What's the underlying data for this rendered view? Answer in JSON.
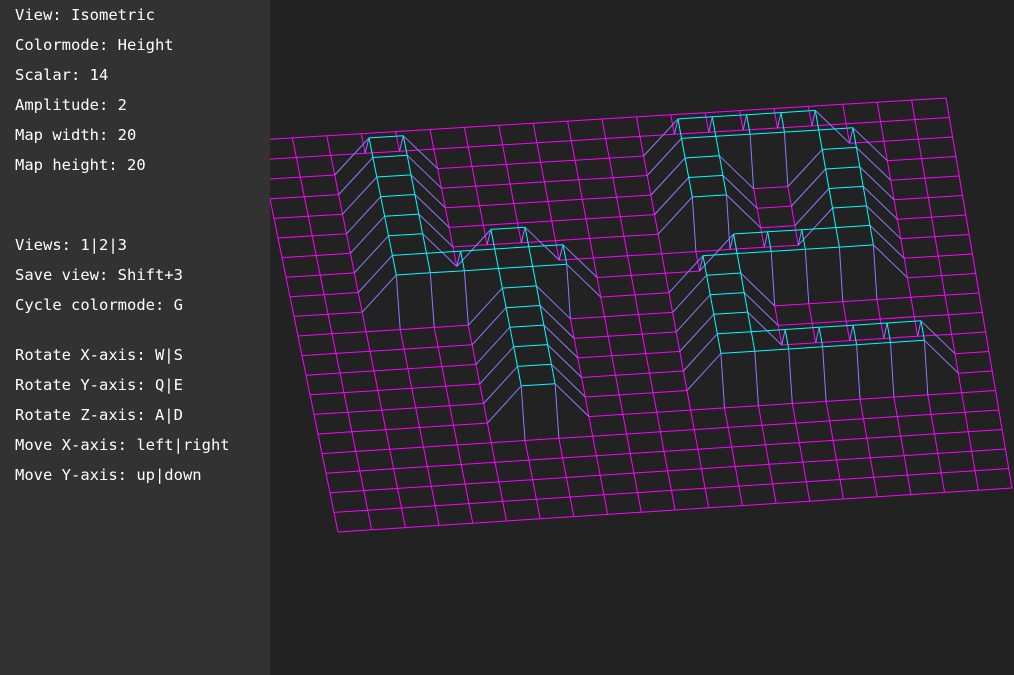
{
  "sidebar": {
    "view": "View: Isometric",
    "colormode": "Colormode: Height",
    "scalar": "Scalar: 14",
    "amplitude": "Amplitude: 2",
    "map_width": "Map width: 20",
    "map_height": "Map height: 20",
    "views": "Views: 1|2|3",
    "save_view": "Save view: Shift+3",
    "cycle_colormode": "Cycle colormode: G",
    "rotate_x": "Rotate X-axis: W|S",
    "rotate_y": "Rotate Y-axis: Q|E",
    "rotate_z": "Rotate Z-axis: A|D",
    "move_x": "Move X-axis: left|right",
    "move_y": "Move Y-axis: up|down"
  },
  "map": {
    "width": 20,
    "height": 20,
    "amplitude": 2,
    "low_color": "#ff00ff",
    "high_color": "#00ffff",
    "background": "#222222",
    "panel_background": "#323232"
  }
}
